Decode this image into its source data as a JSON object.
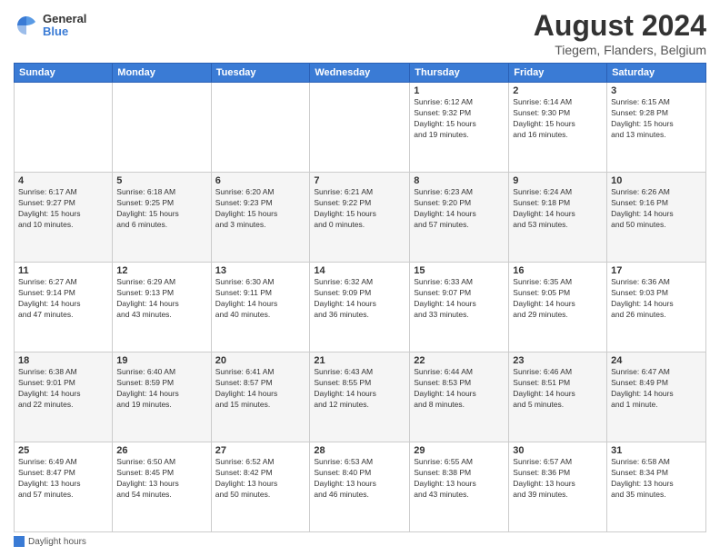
{
  "header": {
    "logo_general": "General",
    "logo_blue": "Blue",
    "month_title": "August 2024",
    "location": "Tiegem, Flanders, Belgium"
  },
  "days_of_week": [
    "Sunday",
    "Monday",
    "Tuesday",
    "Wednesday",
    "Thursday",
    "Friday",
    "Saturday"
  ],
  "weeks": [
    [
      {
        "day": "",
        "info": ""
      },
      {
        "day": "",
        "info": ""
      },
      {
        "day": "",
        "info": ""
      },
      {
        "day": "",
        "info": ""
      },
      {
        "day": "1",
        "info": "Sunrise: 6:12 AM\nSunset: 9:32 PM\nDaylight: 15 hours\nand 19 minutes."
      },
      {
        "day": "2",
        "info": "Sunrise: 6:14 AM\nSunset: 9:30 PM\nDaylight: 15 hours\nand 16 minutes."
      },
      {
        "day": "3",
        "info": "Sunrise: 6:15 AM\nSunset: 9:28 PM\nDaylight: 15 hours\nand 13 minutes."
      }
    ],
    [
      {
        "day": "4",
        "info": "Sunrise: 6:17 AM\nSunset: 9:27 PM\nDaylight: 15 hours\nand 10 minutes."
      },
      {
        "day": "5",
        "info": "Sunrise: 6:18 AM\nSunset: 9:25 PM\nDaylight: 15 hours\nand 6 minutes."
      },
      {
        "day": "6",
        "info": "Sunrise: 6:20 AM\nSunset: 9:23 PM\nDaylight: 15 hours\nand 3 minutes."
      },
      {
        "day": "7",
        "info": "Sunrise: 6:21 AM\nSunset: 9:22 PM\nDaylight: 15 hours\nand 0 minutes."
      },
      {
        "day": "8",
        "info": "Sunrise: 6:23 AM\nSunset: 9:20 PM\nDaylight: 14 hours\nand 57 minutes."
      },
      {
        "day": "9",
        "info": "Sunrise: 6:24 AM\nSunset: 9:18 PM\nDaylight: 14 hours\nand 53 minutes."
      },
      {
        "day": "10",
        "info": "Sunrise: 6:26 AM\nSunset: 9:16 PM\nDaylight: 14 hours\nand 50 minutes."
      }
    ],
    [
      {
        "day": "11",
        "info": "Sunrise: 6:27 AM\nSunset: 9:14 PM\nDaylight: 14 hours\nand 47 minutes."
      },
      {
        "day": "12",
        "info": "Sunrise: 6:29 AM\nSunset: 9:13 PM\nDaylight: 14 hours\nand 43 minutes."
      },
      {
        "day": "13",
        "info": "Sunrise: 6:30 AM\nSunset: 9:11 PM\nDaylight: 14 hours\nand 40 minutes."
      },
      {
        "day": "14",
        "info": "Sunrise: 6:32 AM\nSunset: 9:09 PM\nDaylight: 14 hours\nand 36 minutes."
      },
      {
        "day": "15",
        "info": "Sunrise: 6:33 AM\nSunset: 9:07 PM\nDaylight: 14 hours\nand 33 minutes."
      },
      {
        "day": "16",
        "info": "Sunrise: 6:35 AM\nSunset: 9:05 PM\nDaylight: 14 hours\nand 29 minutes."
      },
      {
        "day": "17",
        "info": "Sunrise: 6:36 AM\nSunset: 9:03 PM\nDaylight: 14 hours\nand 26 minutes."
      }
    ],
    [
      {
        "day": "18",
        "info": "Sunrise: 6:38 AM\nSunset: 9:01 PM\nDaylight: 14 hours\nand 22 minutes."
      },
      {
        "day": "19",
        "info": "Sunrise: 6:40 AM\nSunset: 8:59 PM\nDaylight: 14 hours\nand 19 minutes."
      },
      {
        "day": "20",
        "info": "Sunrise: 6:41 AM\nSunset: 8:57 PM\nDaylight: 14 hours\nand 15 minutes."
      },
      {
        "day": "21",
        "info": "Sunrise: 6:43 AM\nSunset: 8:55 PM\nDaylight: 14 hours\nand 12 minutes."
      },
      {
        "day": "22",
        "info": "Sunrise: 6:44 AM\nSunset: 8:53 PM\nDaylight: 14 hours\nand 8 minutes."
      },
      {
        "day": "23",
        "info": "Sunrise: 6:46 AM\nSunset: 8:51 PM\nDaylight: 14 hours\nand 5 minutes."
      },
      {
        "day": "24",
        "info": "Sunrise: 6:47 AM\nSunset: 8:49 PM\nDaylight: 14 hours\nand 1 minute."
      }
    ],
    [
      {
        "day": "25",
        "info": "Sunrise: 6:49 AM\nSunset: 8:47 PM\nDaylight: 13 hours\nand 57 minutes."
      },
      {
        "day": "26",
        "info": "Sunrise: 6:50 AM\nSunset: 8:45 PM\nDaylight: 13 hours\nand 54 minutes."
      },
      {
        "day": "27",
        "info": "Sunrise: 6:52 AM\nSunset: 8:42 PM\nDaylight: 13 hours\nand 50 minutes."
      },
      {
        "day": "28",
        "info": "Sunrise: 6:53 AM\nSunset: 8:40 PM\nDaylight: 13 hours\nand 46 minutes."
      },
      {
        "day": "29",
        "info": "Sunrise: 6:55 AM\nSunset: 8:38 PM\nDaylight: 13 hours\nand 43 minutes."
      },
      {
        "day": "30",
        "info": "Sunrise: 6:57 AM\nSunset: 8:36 PM\nDaylight: 13 hours\nand 39 minutes."
      },
      {
        "day": "31",
        "info": "Sunrise: 6:58 AM\nSunset: 8:34 PM\nDaylight: 13 hours\nand 35 minutes."
      }
    ]
  ],
  "footer": {
    "legend_label": "Daylight hours"
  }
}
